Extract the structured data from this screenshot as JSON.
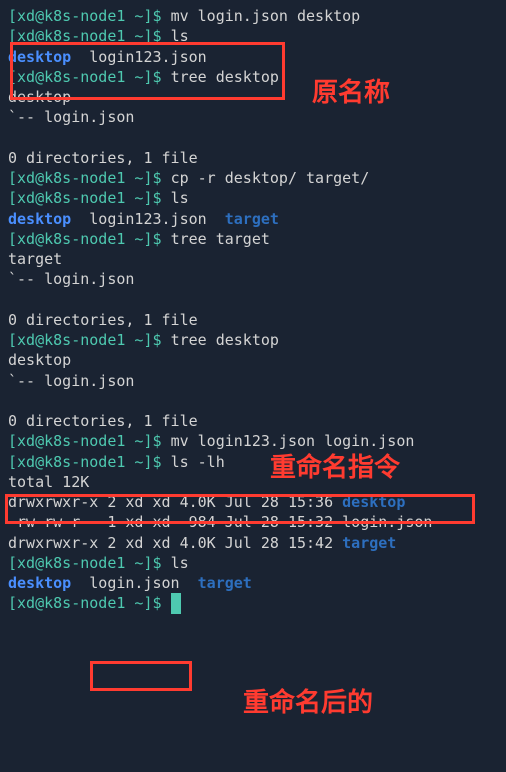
{
  "annotations": {
    "original_name": "原名称",
    "rename_command": "重命名指令",
    "after_rename": "重命名后的"
  },
  "lines": [
    {
      "segments": [
        {
          "cls": "green",
          "t": "[xd@k8s-node1 ~]$ "
        },
        {
          "cls": "white",
          "t": "mv login.json desktop"
        }
      ]
    },
    {
      "segments": [
        {
          "cls": "green",
          "t": "[xd@k8s-node1 ~]$ "
        },
        {
          "cls": "white",
          "t": "ls"
        }
      ]
    },
    {
      "segments": [
        {
          "cls": "blue",
          "t": "desktop"
        },
        {
          "cls": "white",
          "t": "  login123.json"
        }
      ]
    },
    {
      "segments": [
        {
          "cls": "green",
          "t": "[xd@k8s-node1 ~]$ "
        },
        {
          "cls": "white",
          "t": "tree desktop"
        }
      ]
    },
    {
      "segments": [
        {
          "cls": "white",
          "t": "desktop"
        }
      ]
    },
    {
      "segments": [
        {
          "cls": "white",
          "t": "`-- login.json"
        }
      ]
    },
    {
      "segments": [
        {
          "cls": "white",
          "t": " "
        }
      ]
    },
    {
      "segments": [
        {
          "cls": "white",
          "t": "0 directories, 1 file"
        }
      ]
    },
    {
      "segments": [
        {
          "cls": "green",
          "t": "[xd@k8s-node1 ~]$ "
        },
        {
          "cls": "white",
          "t": "cp -r desktop/ target/"
        }
      ]
    },
    {
      "segments": [
        {
          "cls": "green",
          "t": "[xd@k8s-node1 ~]$ "
        },
        {
          "cls": "white",
          "t": "ls"
        }
      ]
    },
    {
      "segments": [
        {
          "cls": "blue",
          "t": "desktop"
        },
        {
          "cls": "white",
          "t": "  login123.json  "
        },
        {
          "cls": "darkblue",
          "t": "target"
        }
      ]
    },
    {
      "segments": [
        {
          "cls": "green",
          "t": "[xd@k8s-node1 ~]$ "
        },
        {
          "cls": "white",
          "t": "tree target"
        }
      ]
    },
    {
      "segments": [
        {
          "cls": "white",
          "t": "target"
        }
      ]
    },
    {
      "segments": [
        {
          "cls": "white",
          "t": "`-- login.json"
        }
      ]
    },
    {
      "segments": [
        {
          "cls": "white",
          "t": " "
        }
      ]
    },
    {
      "segments": [
        {
          "cls": "white",
          "t": "0 directories, 1 file"
        }
      ]
    },
    {
      "segments": [
        {
          "cls": "green",
          "t": "[xd@k8s-node1 ~]$ "
        },
        {
          "cls": "white",
          "t": "tree desktop"
        }
      ]
    },
    {
      "segments": [
        {
          "cls": "white",
          "t": "desktop"
        }
      ]
    },
    {
      "segments": [
        {
          "cls": "white",
          "t": "`-- login.json"
        }
      ]
    },
    {
      "segments": [
        {
          "cls": "white",
          "t": " "
        }
      ]
    },
    {
      "segments": [
        {
          "cls": "white",
          "t": "0 directories, 1 file"
        }
      ]
    },
    {
      "segments": [
        {
          "cls": "green",
          "t": "[xd@k8s-node1 ~]$ "
        },
        {
          "cls": "white",
          "t": "mv login123.json login.json"
        }
      ]
    },
    {
      "segments": [
        {
          "cls": "green",
          "t": "[xd@k8s-node1 ~]$ "
        },
        {
          "cls": "white",
          "t": "ls -lh"
        }
      ]
    },
    {
      "segments": [
        {
          "cls": "white",
          "t": "total 12K"
        }
      ]
    },
    {
      "segments": [
        {
          "cls": "white",
          "t": "drwxrwxr-x 2 xd xd 4.0K Jul 28 15:36 "
        },
        {
          "cls": "darkblue",
          "t": "desktop"
        }
      ]
    },
    {
      "segments": [
        {
          "cls": "white",
          "t": "-rw-rw-r-- 1 xd xd  984 Jul 28 15:32 login.json"
        }
      ]
    },
    {
      "segments": [
        {
          "cls": "white",
          "t": "drwxrwxr-x 2 xd xd 4.0K Jul 28 15:42 "
        },
        {
          "cls": "darkblue",
          "t": "target"
        }
      ]
    },
    {
      "segments": [
        {
          "cls": "green",
          "t": "[xd@k8s-node1 ~]$ "
        },
        {
          "cls": "white",
          "t": "ls"
        }
      ]
    },
    {
      "segments": [
        {
          "cls": "blue",
          "t": "desktop"
        },
        {
          "cls": "white",
          "t": "  login.json  "
        },
        {
          "cls": "darkblue",
          "t": "target"
        }
      ]
    },
    {
      "segments": [
        {
          "cls": "green",
          "t": "[xd@k8s-node1 ~]$ "
        },
        {
          "cls": "cursor",
          "t": " "
        }
      ]
    }
  ]
}
